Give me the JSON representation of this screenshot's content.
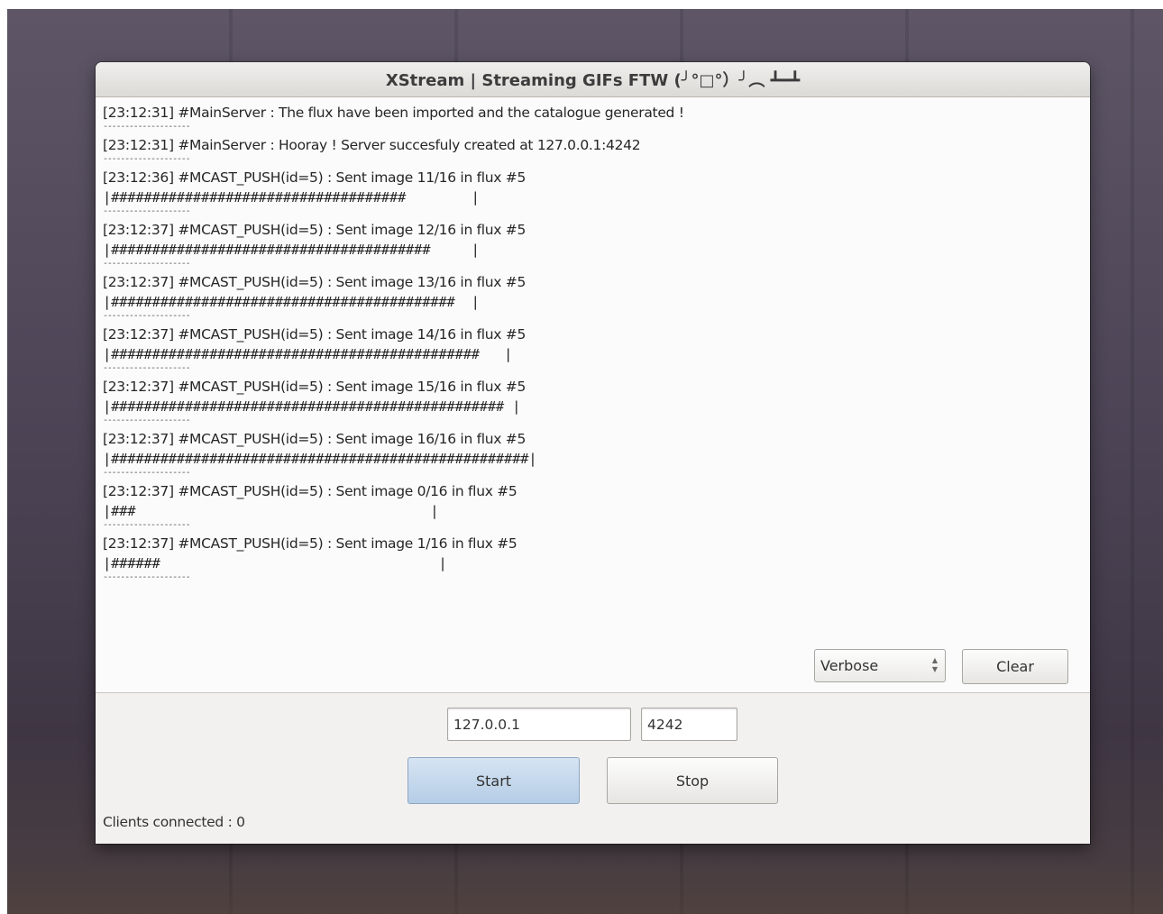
{
  "window": {
    "title": "XStream | Streaming GIFs FTW (╯°□°）╯︵ ┻━┻"
  },
  "log": {
    "entries": [
      {
        "msg": "[23:12:31] #MainServer : The flux have been imported and the catalogue generated !",
        "bar": "",
        "sep": "--------------------"
      },
      {
        "msg": "[23:12:31] #MainServer : Hooray ! Server succesfuly created at 127.0.0.1:4242",
        "bar": "",
        "sep": "--------------------"
      },
      {
        "msg": "[23:12:36] #MCAST_PUSH(id=5) : Sent image 11/16 in flux #5",
        "bar": "|####################################        |",
        "sep": "--------------------"
      },
      {
        "msg": "[23:12:37] #MCAST_PUSH(id=5) : Sent image 12/16 in flux #5",
        "bar": "|#######################################     |",
        "sep": "--------------------"
      },
      {
        "msg": "[23:12:37] #MCAST_PUSH(id=5) : Sent image 13/16 in flux #5",
        "bar": "|##########################################  |",
        "sep": "--------------------"
      },
      {
        "msg": "[23:12:37] #MCAST_PUSH(id=5) : Sent image 14/16 in flux #5",
        "bar": "|#############################################   |",
        "sep": "--------------------"
      },
      {
        "msg": "[23:12:37] #MCAST_PUSH(id=5) : Sent image 15/16 in flux #5",
        "bar": "|################################################ |",
        "sep": "--------------------"
      },
      {
        "msg": "[23:12:37] #MCAST_PUSH(id=5) : Sent image 16/16 in flux #5",
        "bar": "|###################################################|",
        "sep": "--------------------"
      },
      {
        "msg": "[23:12:37] #MCAST_PUSH(id=5) : Sent image 0/16 in flux #5",
        "bar": "|###                                    |",
        "sep": "--------------------"
      },
      {
        "msg": "[23:12:37] #MCAST_PUSH(id=5) : Sent image 1/16 in flux #5",
        "bar": "|######                                  |",
        "sep": "--------------------"
      }
    ]
  },
  "controls": {
    "log_level": "Verbose",
    "clear_label": "Clear",
    "host_value": "127.0.0.1",
    "port_value": "4242",
    "start_label": "Start",
    "stop_label": "Stop"
  },
  "status": {
    "clients_connected": "Clients connected : 0"
  }
}
